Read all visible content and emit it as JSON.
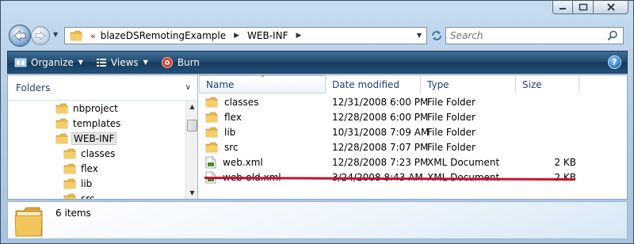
{
  "window": {
    "caption_buttons": [
      "minimize-icon",
      "maximize-icon",
      "close-icon"
    ]
  },
  "navigation": {
    "breadcrumb_prefix": "«",
    "breadcrumbs": [
      "blazeDSRemotingExample",
      "WEB-INF"
    ],
    "search_placeholder": "Search"
  },
  "toolbar": {
    "organize_label": "Organize",
    "views_label": "Views",
    "burn_label": "Burn",
    "help_label": "?"
  },
  "nav_pane": {
    "header": "Folders",
    "tree": [
      {
        "label": "nbproject",
        "level": 1,
        "selected": false
      },
      {
        "label": "templates",
        "level": 1,
        "selected": false
      },
      {
        "label": "WEB-INF",
        "level": 1,
        "selected": true
      },
      {
        "label": "classes",
        "level": 2,
        "selected": false
      },
      {
        "label": "flex",
        "level": 2,
        "selected": false
      },
      {
        "label": "lib",
        "level": 2,
        "selected": false
      },
      {
        "label": "src",
        "level": 2,
        "selected": false
      }
    ]
  },
  "file_list": {
    "columns": [
      "Name",
      "Date modified",
      "Type",
      "Size"
    ],
    "rows": [
      {
        "name": "classes",
        "date": "12/31/2008 6:00 PM",
        "type": "File Folder",
        "size": "",
        "icon": "folder-icon"
      },
      {
        "name": "flex",
        "date": "12/28/2008 6:00 PM",
        "type": "File Folder",
        "size": "",
        "icon": "folder-icon"
      },
      {
        "name": "lib",
        "date": "10/31/2008 7:09 AM",
        "type": "File Folder",
        "size": "",
        "icon": "folder-icon"
      },
      {
        "name": "src",
        "date": "12/28/2008 7:07 PM",
        "type": "File Folder",
        "size": "",
        "icon": "folder-icon"
      },
      {
        "name": "web.xml",
        "date": "12/28/2008 7:23 PM",
        "type": "XML Document",
        "size": "2 KB",
        "icon": "xml-file-icon"
      },
      {
        "name": "web-old.xml",
        "date": "3/24/2008 8:43 AM",
        "type": "XML Document",
        "size": "2 KB",
        "icon": "xml-file-icon"
      }
    ]
  },
  "details": {
    "item_count": "6 items"
  },
  "colors": {
    "toolbar": "#224a6d",
    "strike_line": "#c8102e",
    "folder": "#e8b64a"
  }
}
